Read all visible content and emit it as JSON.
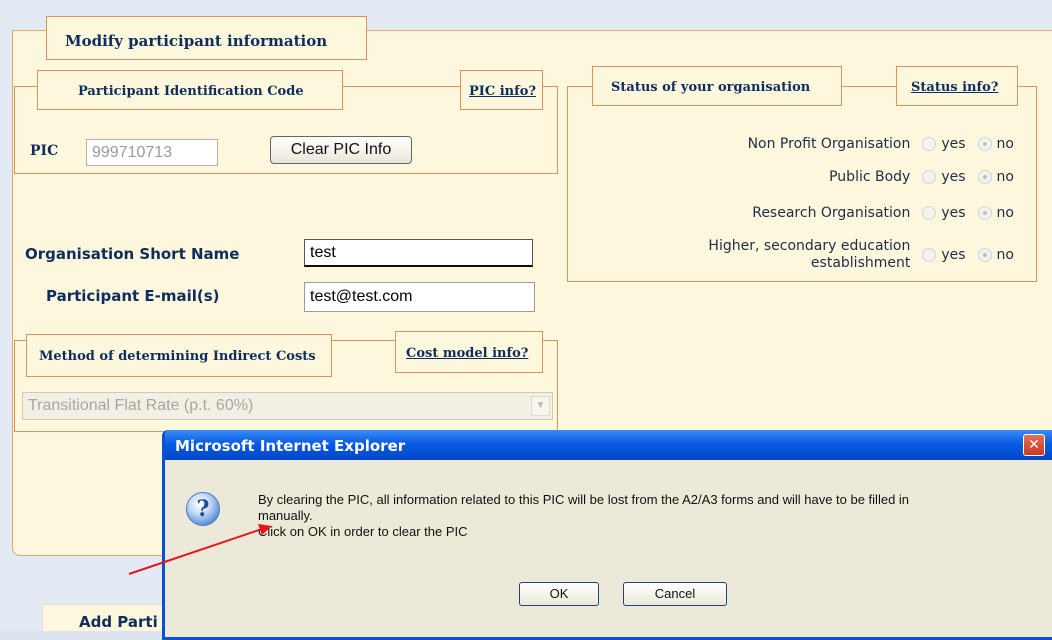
{
  "form": {
    "title": "Modify participant information",
    "pic_section": {
      "title": "Participant Identification Code",
      "info_link": "PIC info?",
      "pic_label": "PIC",
      "pic_value": "999710713",
      "clear_button": "Clear PIC Info"
    },
    "status_section": {
      "title": "Status of your organisation",
      "info_link": "Status info?",
      "rows": [
        {
          "label": "Non Profit Organisation",
          "yes": "yes",
          "no": "no",
          "selected": "no"
        },
        {
          "label": "Public Body",
          "yes": "yes",
          "no": "no",
          "selected": "no"
        },
        {
          "label": "Research Organisation",
          "yes": "yes",
          "no": "no",
          "selected": "no"
        },
        {
          "label_line1": "Higher, secondary education",
          "label_line2": "establishment",
          "yes": "yes",
          "no": "no",
          "selected": "no"
        }
      ]
    },
    "short_name": {
      "label": "Organisation Short Name",
      "value": "test"
    },
    "email": {
      "label": "Participant E-mail(s)",
      "value": "test@test.com"
    },
    "cost_section": {
      "title": "Method of determining Indirect Costs",
      "info_link": "Cost model info?",
      "selected": "Transitional Flat Rate (p.t. 60%)"
    },
    "bottom_tab": "Add Parti"
  },
  "dialog": {
    "title": "Microsoft Internet Explorer",
    "close": "✕",
    "icon": "question-icon",
    "line1": "By clearing the PIC, all information related to this PIC will be lost from the A2/A3 forms and will have to be filled in",
    "line2": "manually.",
    "line3": "Click on OK in order to clear the PIC",
    "ok": "OK",
    "cancel": "Cancel"
  },
  "colors": {
    "panel_bg": "#fdf8dd",
    "border": "#d8945a",
    "text": "#0e2d5c",
    "dialog_title": "#0a5be3",
    "arrow": "#e8141c"
  }
}
